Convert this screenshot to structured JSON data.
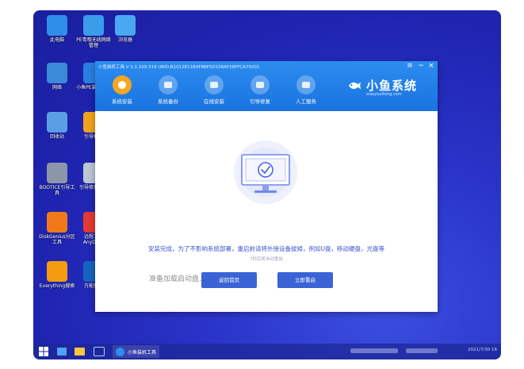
{
  "desktop_icons": [
    {
      "label": "此电脑",
      "icon": "computer-icon",
      "color": "#2f8fe8"
    },
    {
      "label": "PE粤哦无线网络管理",
      "icon": "network-icon",
      "color": "#3a9de9"
    },
    {
      "label": "浏览器",
      "icon": "browser-icon",
      "color": "#4aa8f0"
    },
    {
      "label": "网络",
      "icon": "globe-icon",
      "color": "#3b8ad8"
    },
    {
      "label": "小鱼PE装机工具",
      "icon": "installer-icon",
      "color": "#2b7fe0"
    },
    {
      "label": "回收站",
      "icon": "recycle-bin-icon",
      "color": "#5c9ee6"
    },
    {
      "label": "引导修复",
      "icon": "boot-repair-icon",
      "color": "#f0a31c"
    },
    {
      "label": "BOOTICE引导工具",
      "icon": "bootice-icon",
      "color": "#8b97a8"
    },
    {
      "label": "引导修复工具",
      "icon": "repair-icon",
      "color": "#bcc6d4"
    },
    {
      "label": "DiskGenius分区工具",
      "icon": "diskgenius-icon",
      "color": "#f07a1a"
    },
    {
      "label": "远程工具AnyDesk",
      "icon": "anydesk-icon",
      "color": "#e53935"
    },
    {
      "label": "Everything搜索",
      "icon": "search-icon",
      "color": "#f39c12"
    },
    {
      "label": "万能驱动",
      "icon": "driver-icon",
      "color": "#1565c0"
    }
  ],
  "window": {
    "title": "小鱼装机工具 V 3.1.329.319 URID:B1012E11B4F8BF5D158AF56FFCA75001",
    "menu_glyph": "≡",
    "minimize_glyph": "−",
    "close_glyph": "×",
    "tabs": [
      {
        "label": "系统安装",
        "active": true
      },
      {
        "label": "系统备份",
        "active": false
      },
      {
        "label": "在线安装",
        "active": false
      },
      {
        "label": "引导修复",
        "active": false
      },
      {
        "label": "人工服务",
        "active": false
      }
    ],
    "brand_name": "小鱼系统",
    "brand_url": "xiaoyuxitong.com"
  },
  "content": {
    "message": "安装完成，为了不影响系统部署，重启前请将外接设备拔掉，例如U盘，移动硬盘，光盘等",
    "countdown": "7秒后将自动重启",
    "btn_home": "返回首页",
    "btn_restart": "立即重启",
    "ghost_text": "准备加载启动盘…"
  },
  "taskbar": {
    "app_label": "小鱼装机工具",
    "clock": "2021/7/30 16"
  },
  "colors": {
    "accent": "#3a63d6",
    "header": "#1a73e0",
    "desktop": "#2a34c9"
  }
}
